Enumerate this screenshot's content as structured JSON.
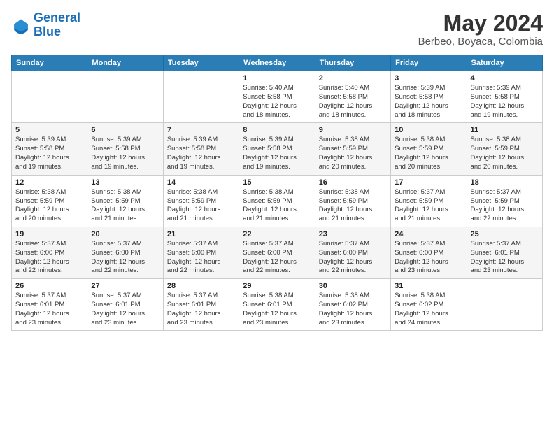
{
  "logo": {
    "line1": "General",
    "line2": "Blue"
  },
  "title": "May 2024",
  "location": "Berbeo, Boyaca, Colombia",
  "weekdays": [
    "Sunday",
    "Monday",
    "Tuesday",
    "Wednesday",
    "Thursday",
    "Friday",
    "Saturday"
  ],
  "weeks": [
    [
      {
        "day": "",
        "info": ""
      },
      {
        "day": "",
        "info": ""
      },
      {
        "day": "",
        "info": ""
      },
      {
        "day": "1",
        "info": "Sunrise: 5:40 AM\nSunset: 5:58 PM\nDaylight: 12 hours\nand 18 minutes."
      },
      {
        "day": "2",
        "info": "Sunrise: 5:40 AM\nSunset: 5:58 PM\nDaylight: 12 hours\nand 18 minutes."
      },
      {
        "day": "3",
        "info": "Sunrise: 5:39 AM\nSunset: 5:58 PM\nDaylight: 12 hours\nand 18 minutes."
      },
      {
        "day": "4",
        "info": "Sunrise: 5:39 AM\nSunset: 5:58 PM\nDaylight: 12 hours\nand 19 minutes."
      }
    ],
    [
      {
        "day": "5",
        "info": "Sunrise: 5:39 AM\nSunset: 5:58 PM\nDaylight: 12 hours\nand 19 minutes."
      },
      {
        "day": "6",
        "info": "Sunrise: 5:39 AM\nSunset: 5:58 PM\nDaylight: 12 hours\nand 19 minutes."
      },
      {
        "day": "7",
        "info": "Sunrise: 5:39 AM\nSunset: 5:58 PM\nDaylight: 12 hours\nand 19 minutes."
      },
      {
        "day": "8",
        "info": "Sunrise: 5:39 AM\nSunset: 5:58 PM\nDaylight: 12 hours\nand 19 minutes."
      },
      {
        "day": "9",
        "info": "Sunrise: 5:38 AM\nSunset: 5:59 PM\nDaylight: 12 hours\nand 20 minutes."
      },
      {
        "day": "10",
        "info": "Sunrise: 5:38 AM\nSunset: 5:59 PM\nDaylight: 12 hours\nand 20 minutes."
      },
      {
        "day": "11",
        "info": "Sunrise: 5:38 AM\nSunset: 5:59 PM\nDaylight: 12 hours\nand 20 minutes."
      }
    ],
    [
      {
        "day": "12",
        "info": "Sunrise: 5:38 AM\nSunset: 5:59 PM\nDaylight: 12 hours\nand 20 minutes."
      },
      {
        "day": "13",
        "info": "Sunrise: 5:38 AM\nSunset: 5:59 PM\nDaylight: 12 hours\nand 21 minutes."
      },
      {
        "day": "14",
        "info": "Sunrise: 5:38 AM\nSunset: 5:59 PM\nDaylight: 12 hours\nand 21 minutes."
      },
      {
        "day": "15",
        "info": "Sunrise: 5:38 AM\nSunset: 5:59 PM\nDaylight: 12 hours\nand 21 minutes."
      },
      {
        "day": "16",
        "info": "Sunrise: 5:38 AM\nSunset: 5:59 PM\nDaylight: 12 hours\nand 21 minutes."
      },
      {
        "day": "17",
        "info": "Sunrise: 5:37 AM\nSunset: 5:59 PM\nDaylight: 12 hours\nand 21 minutes."
      },
      {
        "day": "18",
        "info": "Sunrise: 5:37 AM\nSunset: 5:59 PM\nDaylight: 12 hours\nand 22 minutes."
      }
    ],
    [
      {
        "day": "19",
        "info": "Sunrise: 5:37 AM\nSunset: 6:00 PM\nDaylight: 12 hours\nand 22 minutes."
      },
      {
        "day": "20",
        "info": "Sunrise: 5:37 AM\nSunset: 6:00 PM\nDaylight: 12 hours\nand 22 minutes."
      },
      {
        "day": "21",
        "info": "Sunrise: 5:37 AM\nSunset: 6:00 PM\nDaylight: 12 hours\nand 22 minutes."
      },
      {
        "day": "22",
        "info": "Sunrise: 5:37 AM\nSunset: 6:00 PM\nDaylight: 12 hours\nand 22 minutes."
      },
      {
        "day": "23",
        "info": "Sunrise: 5:37 AM\nSunset: 6:00 PM\nDaylight: 12 hours\nand 22 minutes."
      },
      {
        "day": "24",
        "info": "Sunrise: 5:37 AM\nSunset: 6:00 PM\nDaylight: 12 hours\nand 23 minutes."
      },
      {
        "day": "25",
        "info": "Sunrise: 5:37 AM\nSunset: 6:01 PM\nDaylight: 12 hours\nand 23 minutes."
      }
    ],
    [
      {
        "day": "26",
        "info": "Sunrise: 5:37 AM\nSunset: 6:01 PM\nDaylight: 12 hours\nand 23 minutes."
      },
      {
        "day": "27",
        "info": "Sunrise: 5:37 AM\nSunset: 6:01 PM\nDaylight: 12 hours\nand 23 minutes."
      },
      {
        "day": "28",
        "info": "Sunrise: 5:37 AM\nSunset: 6:01 PM\nDaylight: 12 hours\nand 23 minutes."
      },
      {
        "day": "29",
        "info": "Sunrise: 5:38 AM\nSunset: 6:01 PM\nDaylight: 12 hours\nand 23 minutes."
      },
      {
        "day": "30",
        "info": "Sunrise: 5:38 AM\nSunset: 6:02 PM\nDaylight: 12 hours\nand 23 minutes."
      },
      {
        "day": "31",
        "info": "Sunrise: 5:38 AM\nSunset: 6:02 PM\nDaylight: 12 hours\nand 24 minutes."
      },
      {
        "day": "",
        "info": ""
      }
    ]
  ]
}
